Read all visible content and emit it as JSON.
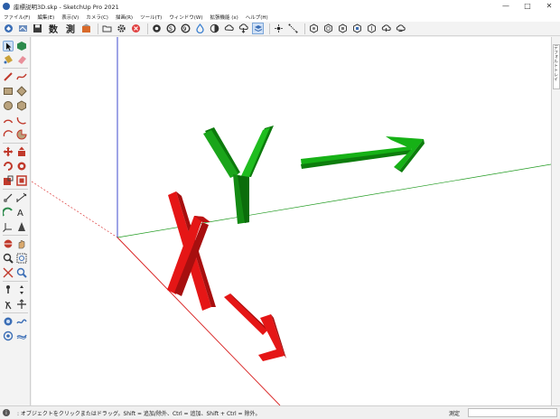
{
  "window": {
    "title": "座標説明3D.skp - SketchUp Pro 2021",
    "minimize": "—",
    "maximize": "□",
    "close": "✕"
  },
  "menu": [
    "ファイル(F)",
    "編集(E)",
    "表示(V)",
    "カメラ(C)",
    "描画(R)",
    "ツール(T)",
    "ウィンドウ(W)",
    "拡張機能 (x)",
    "ヘルプ(H)"
  ],
  "toolbar": {
    "text_buttons": [
      "数",
      "測"
    ],
    "icons": [
      "sketchup-icon",
      "model-info-icon",
      "save-icon",
      "count-icon",
      "measure-icon",
      "warehouse-icon",
      "open-icon",
      "settings-gear-icon",
      "stop-icon",
      "section-icon",
      "section-display-icon",
      "section-fill-icon",
      "xray-icon",
      "back-edges-icon",
      "cloud-upload-icon",
      "cloud-download-icon",
      "layers-icon",
      "point-icon",
      "dimension-icon",
      "solid-union-icon",
      "solid-intersect-icon",
      "solid-subtract-icon",
      "solid-trim-icon",
      "solid-split-icon",
      "cloud-sync-icon",
      "cloud-share-icon"
    ]
  },
  "tray": {
    "tab_label": "デフォルトトレイ"
  },
  "scene": {
    "colors": {
      "red_axis": "#d81f1f",
      "green_axis": "#1f9a1f",
      "blue_axis": "#2a37c9",
      "arrow_green": "#16b116",
      "arrow_red": "#e51616"
    },
    "letters": {
      "x": "X",
      "y": "Y"
    }
  },
  "status": {
    "icon": "i",
    "hint": ": オブジェクトをクリックまたはドラッグ。Shift = 追加/除外、Ctrl = 追加、Shift + Ctrl = 除外。",
    "measure_label": "測定",
    "measure_value": ""
  }
}
